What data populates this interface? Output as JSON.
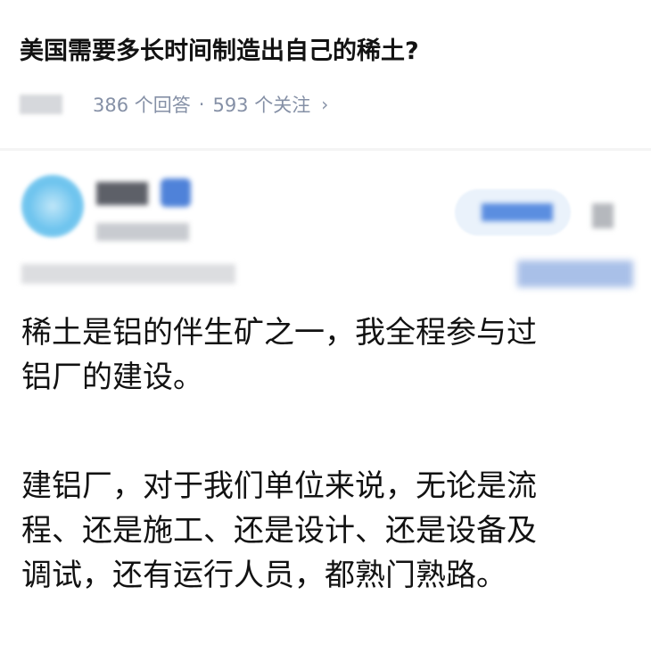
{
  "question": {
    "title": "美国需要多长时间制造出自己的稀土?",
    "answers_count": "386 个回答",
    "separator": "·",
    "followers_count": "593 个关注",
    "chevron": "›"
  },
  "author": {
    "avatar_icon": "avatar-icon",
    "badge_icon": "verified-badge-icon",
    "follow_button": "follow-button",
    "more_icon": "more-icon"
  },
  "answer": {
    "paragraph1_line1": "稀土是铝的伴生矿之一，我全程参与过",
    "paragraph1_line2": "铝厂的建设。",
    "paragraph2_line1": "建铝厂，对于我们单位来说，无论是流",
    "paragraph2_line2": "程、还是施工、还是设计、还是设备及",
    "paragraph2_line3": "调试，还有运行人员，都熟门熟路。"
  }
}
